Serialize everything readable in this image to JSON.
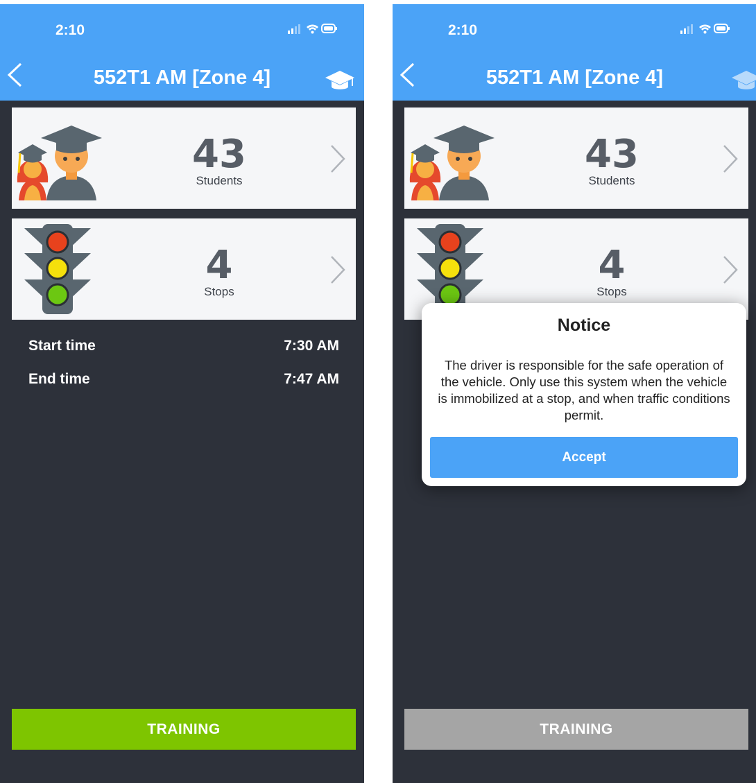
{
  "screens": [
    {
      "id": "left",
      "status": {
        "time": "2:10"
      },
      "header": {
        "title": "552T1 AM [Zone 4]",
        "back_icon": "chevron-left-icon",
        "right_icon": "graduation-cap-icon"
      },
      "cards": [
        {
          "count": "43",
          "label": "Students",
          "icon": "students-icon"
        },
        {
          "count": "4",
          "label": "Stops",
          "icon": "traffic-light-icon"
        }
      ],
      "info": [
        {
          "label": "Start time",
          "value": "7:30 AM"
        },
        {
          "label": "End time",
          "value": "7:47 AM"
        }
      ],
      "button": {
        "label": "TRAINING",
        "color": "#7ec500",
        "state": "enabled"
      }
    },
    {
      "id": "right",
      "status": {
        "time": "2:10"
      },
      "header": {
        "title": "552T1 AM [Zone 4]",
        "back_icon": "chevron-left-icon",
        "right_icon": "graduation-cap-icon"
      },
      "cards": [
        {
          "count": "43",
          "label": "Students",
          "icon": "students-icon"
        },
        {
          "count": "4",
          "label": "Stops",
          "icon": "traffic-light-icon"
        }
      ],
      "button": {
        "label": "TRAINING",
        "color": "#a5a5a5",
        "state": "disabled"
      },
      "dialog": {
        "title": "Notice",
        "message": "The driver is responsible for the safe operation of the vehicle. Only use this system when the vehicle is immobilized at a stop, and when traffic conditions permit.",
        "button_label": "Accept"
      }
    }
  ],
  "colors": {
    "header": "#4ba3f7",
    "background": "#2d313a",
    "card": "#f5f6f8",
    "training_enabled": "#7ec500",
    "training_disabled": "#a5a5a5",
    "accept": "#4ba3f7"
  }
}
